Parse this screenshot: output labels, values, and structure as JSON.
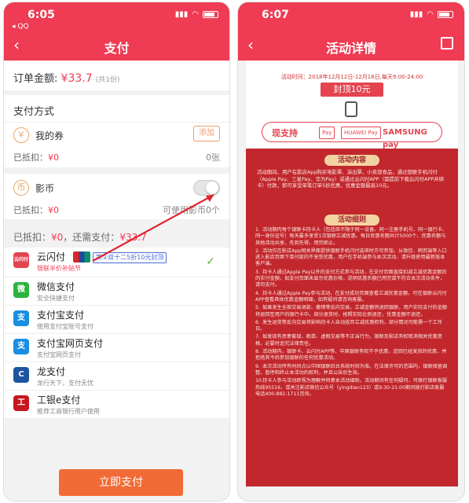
{
  "left": {
    "status": {
      "time": "6:05",
      "app": "◂ QQ"
    },
    "nav": {
      "title": "支付"
    },
    "order": {
      "label": "订单金额:",
      "amount": "¥33.7",
      "qty": "(共1份)"
    },
    "pay_method_title": "支付方式",
    "coupon": {
      "icon": "¥",
      "label": "我的券",
      "add": "添加",
      "deducted_label": "已抵扣：",
      "deducted": "¥0",
      "count": "0张"
    },
    "coin": {
      "icon": "币",
      "label": "影币",
      "deducted_label": "已抵扣：",
      "deducted": "¥0",
      "available": "可使用影币0个"
    },
    "summary": {
      "deducted_label": "已抵扣：",
      "deducted": "¥0",
      "still_label": "，还需支付：",
      "still": "¥33.7"
    },
    "methods": [
      {
        "name": "云闪付",
        "desc": "银联半价补贴节",
        "promo": "第②双十二5折10元封顶",
        "icon": "云闪付",
        "color": "#e34450",
        "selected": true
      },
      {
        "name": "微信支付",
        "desc": "安全快捷支付",
        "icon": "微",
        "color": "#2bb33d"
      },
      {
        "name": "支付宝支付",
        "desc": "使用支付宝账号支付",
        "icon": "支",
        "color": "#1a8fe0"
      },
      {
        "name": "支付宝网页支付",
        "desc": "支付宝网页支付",
        "icon": "支",
        "color": "#1a8fe0"
      },
      {
        "name": "龙支付",
        "desc": "龙行天下，支付无忧",
        "icon": "C",
        "color": "#1c55a0"
      },
      {
        "name": "工银e支付",
        "desc": "推荐工商银行用户使用",
        "icon": "工",
        "color": "#c7161e"
      }
    ],
    "submit": "立即支付"
  },
  "right": {
    "status": {
      "time": "6:07"
    },
    "nav": {
      "title": "活动详情"
    },
    "banner": {
      "time": "活动时间：2018年12月12日-12月16日,每天9:00-24:00",
      "cap": "封顶10元",
      "support": "现支持",
      "brands": [
        "Pay",
        "HUAWEI Pay",
        "SAMSUNG pay"
      ]
    },
    "content_title": "活动内容",
    "content": "活动期间，用户在影店App购买电影票、演出票、小卖部食品，通过银联手机闪付（Apple Pay、三星Pay、华为Pay）或通过云闪付APP（需提前下载云闪付APP并绑卡）付款，即可享受单笔订单5折优惠，优惠金额最高10元。",
    "rules_title": "活动细则",
    "rules": [
      "活动期内每个银联卡持卡人（包括但不限于同一设备、同一注册手机号、同一银行卡、同一身份证号）每天最多享受1次银联立减优惠。每日优惠名额共计5000个，优惠名额与其他活动共享，先到先得，用完即止。",
      "活动仅在影店App相关界面提供银联手机闪付选项时方可参加，从微信、网页端等入口进入影店页面下单付款的不享受优惠，用户在手机端参与本次活动，请升级使用最新版本客户端。",
      "持卡人通过Apple Pay以外的支付方式参与活动，在支付页面直接扣减立减优惠金额后的实付金额，如支付页面未显示优惠价格，说明优惠名额已用完或不符合本次活动条件，请勿支付。",
      "持卡人通过Apple Pay参与活动，在支付成功页面查看立减优惠金额，可在银联云闪付APP查看具体优惠金额明细，如有疑问请咨询客服。",
      "如果发生全部交易退款、撤销等反向交易，立减金额将退回银联，用户实际支付的金额将退回至用户的银行卡中，部分退货时，按照实际比例退还，优惠金额不退还。",
      "发生退货等反向交易将影响持卡人自动放弃立减优惠权利，部分情况可能需一个工作日。",
      "如发现有恶意套现、刷单、虚假交易等不正当行为，银联及影店有权取消相关优惠资格，必要时追究法律责任。",
      "活动期内，银联卡、云闪付APP等、中国银联有权不予优惠，追回已经发放的优惠，并拒绝其今后参加银联的任何优惠活动。",
      "本次活动所有时间点以中国银联后台系统时间为准。在法律许可的范围内，银联保留调整、暂停和终止本活动的权利，并且公告后生效。",
      "持卡人参与活动即视为理解并同意本活动细则。活动期间有任何疑问，可拨打银联客服热线95516，或关注影店微信公众号（yingdian123）或9:30-21:00期间拨打影店客服电话400-882-1711咨询。"
    ]
  }
}
